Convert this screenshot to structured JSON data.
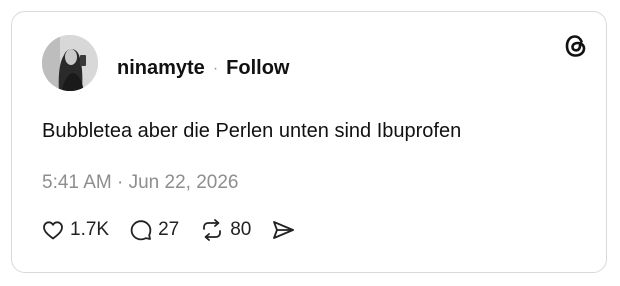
{
  "post": {
    "username": "ninamyte",
    "separator": "·",
    "follow_label": "Follow",
    "text": "Bubbletea aber die Perlen unten sind Ibuprofen",
    "timestamp": "5:41 AM · Jun 22, 2026",
    "likes": "1.7K",
    "replies": "27",
    "reposts": "80"
  },
  "icons": {
    "logo": "threads-logo-icon",
    "like": "heart-icon",
    "reply": "speech-bubble-icon",
    "repost": "repost-arrows-icon",
    "share": "send-icon"
  },
  "colors": {
    "text": "#111111",
    "muted": "#8e8e8e",
    "border": "#d9d9d9"
  }
}
